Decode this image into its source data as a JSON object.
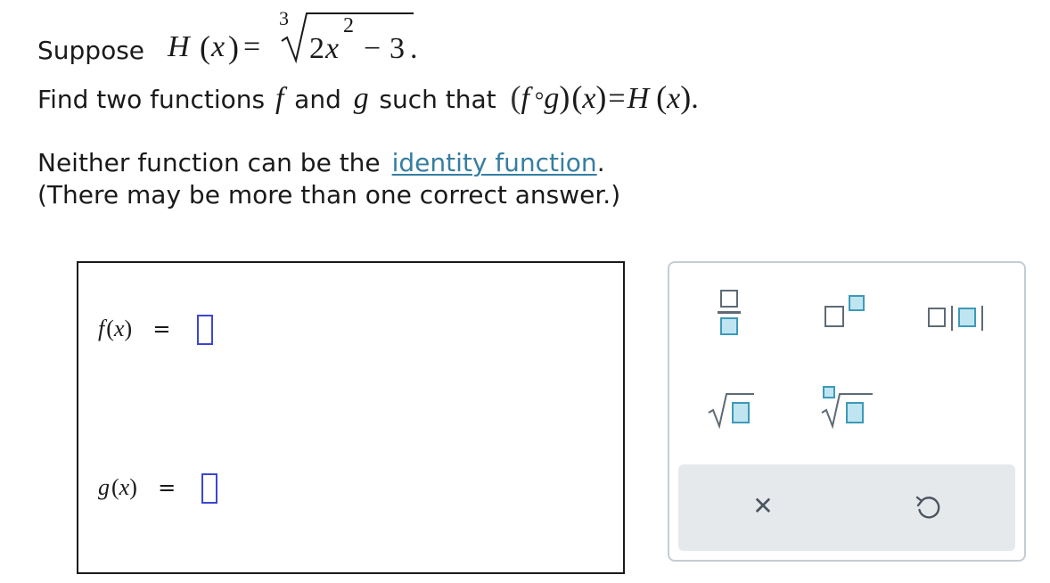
{
  "problem": {
    "line1_prefix": "Suppose",
    "H": "H",
    "x": "x",
    "eq": "=",
    "root_index": "3",
    "coef": "2",
    "exp": "2",
    "minus": "−",
    "const": "3",
    "period": ".",
    "line2_prefix": "Find two functions",
    "f": "f",
    "and_word": "and",
    "g": "g",
    "such_that": "such that",
    "compose": "°",
    "line3_prefix": "Neither function can be the",
    "identity_link": "identity function",
    "line4": "(There may be more than one correct answer.)"
  },
  "answers": {
    "f_label": "f",
    "g_label": "g",
    "x_label": "x",
    "equals": "=",
    "f_value": "",
    "g_value": ""
  },
  "palette": {
    "tools": [
      "fraction-icon",
      "superscript-icon",
      "absolute-value-icon",
      "square-root-icon",
      "nth-root-icon"
    ],
    "clear_icon": "✕",
    "undo_icon": "undo-icon"
  },
  "colors": {
    "link": "#357ea1",
    "input_border": "#3b46d4",
    "tool_fill": "#bfe5f1",
    "tool_accent": "#3d9ab8",
    "action_bar": "#e6e9ec"
  }
}
